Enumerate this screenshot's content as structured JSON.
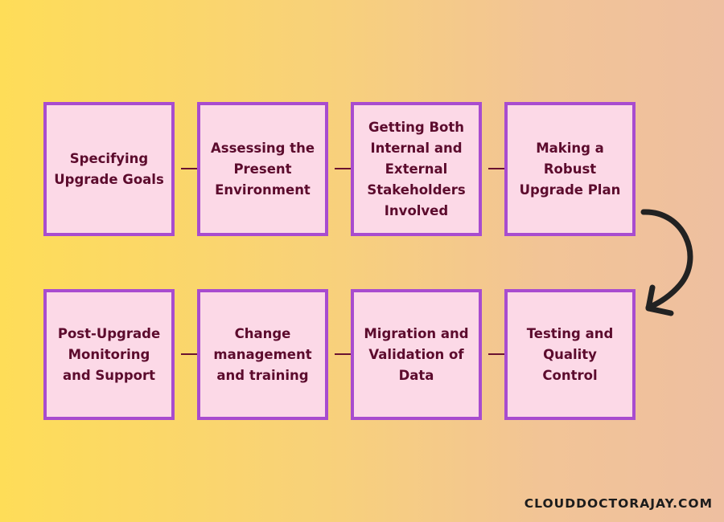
{
  "steps_row1": [
    "Specifying Upgrade Goals",
    "Assessing the Present Environment",
    "Getting Both Internal and External Stakeholders Involved",
    "Making a Robust Upgrade Plan"
  ],
  "steps_row2": [
    "Post-Upgrade Monitoring and Support",
    "Change management and training",
    "Migration and Validation of Data",
    "Testing and Quality Control"
  ],
  "brand": "CLOUDDOCTORAJAY.COM",
  "colors": {
    "box_fill": "#fcd9e7",
    "box_border": "#a84ccf",
    "text": "#5c0b2d",
    "arrow": "#222222"
  },
  "icons": {
    "turn": "curved-arrow-icon"
  }
}
